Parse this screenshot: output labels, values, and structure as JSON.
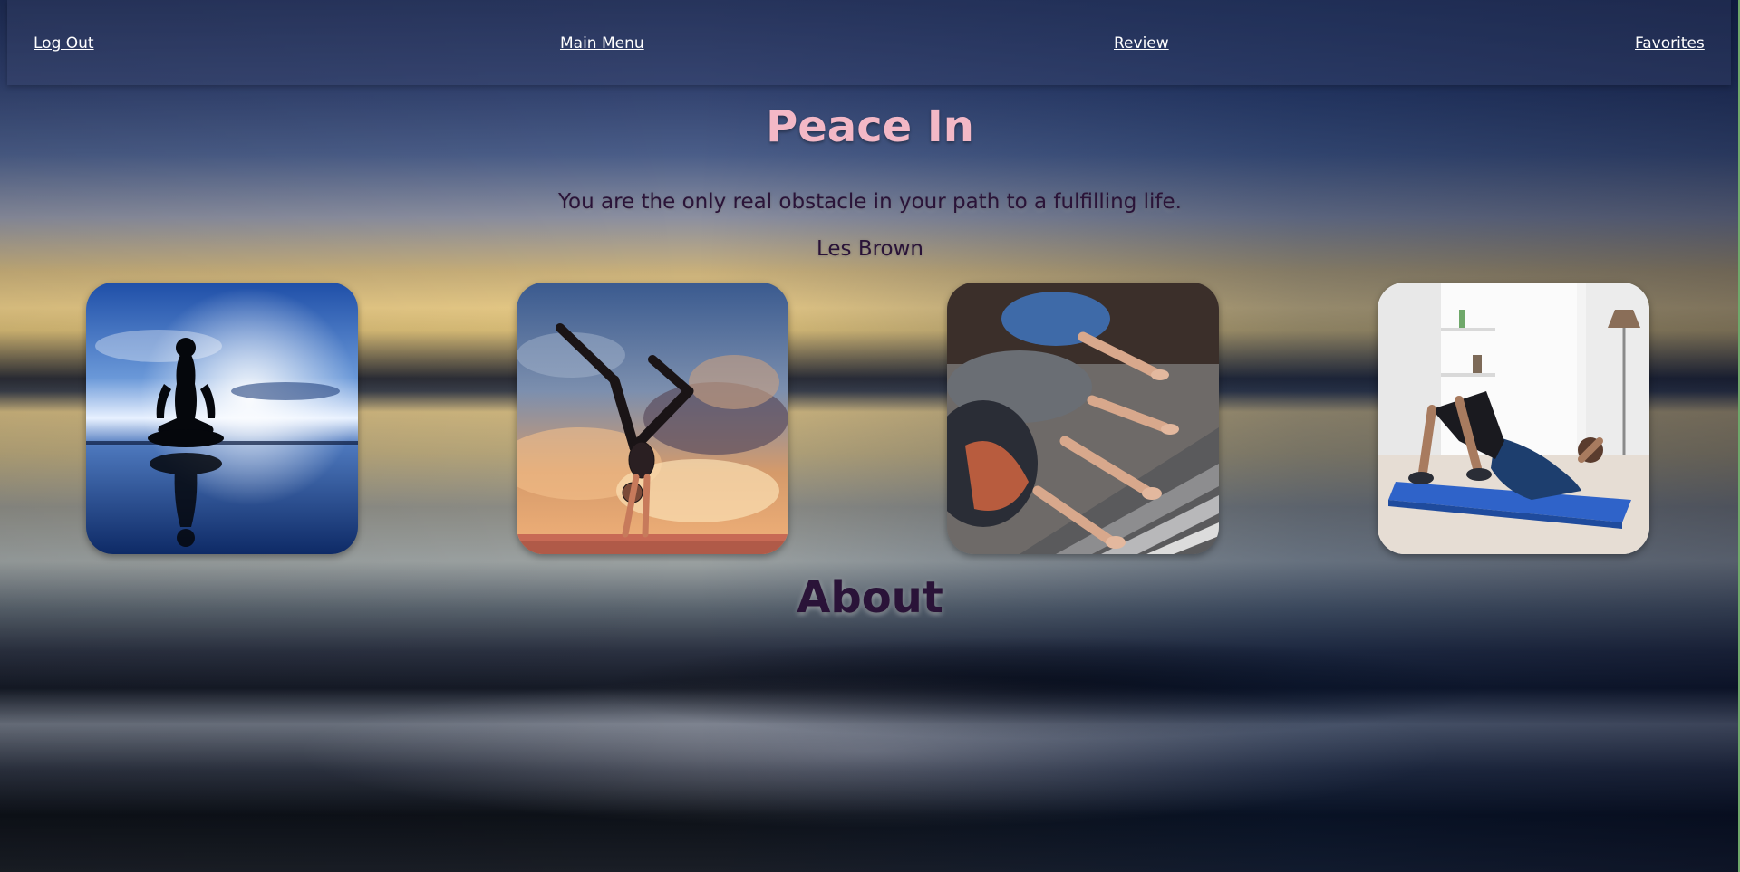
{
  "nav": {
    "logout_label": "Log Out",
    "main_menu_label": "Main Menu",
    "review_label": "Review",
    "favorites_label": "Favorites"
  },
  "hero": {
    "title": "Peace In",
    "quote": "You are the only real obstacle in your path to a fulfilling life.",
    "author": "Les Brown"
  },
  "gallery": {
    "images": [
      {
        "name": "meditation-silhouette-image"
      },
      {
        "name": "handstand-yoga-image"
      },
      {
        "name": "group-stretch-class-image"
      },
      {
        "name": "situps-exercise-image"
      }
    ]
  },
  "about": {
    "heading": "About"
  },
  "colors": {
    "title": "#f3b8c6",
    "heading_dark": "#2a1338",
    "nav_text": "#ffffff"
  }
}
